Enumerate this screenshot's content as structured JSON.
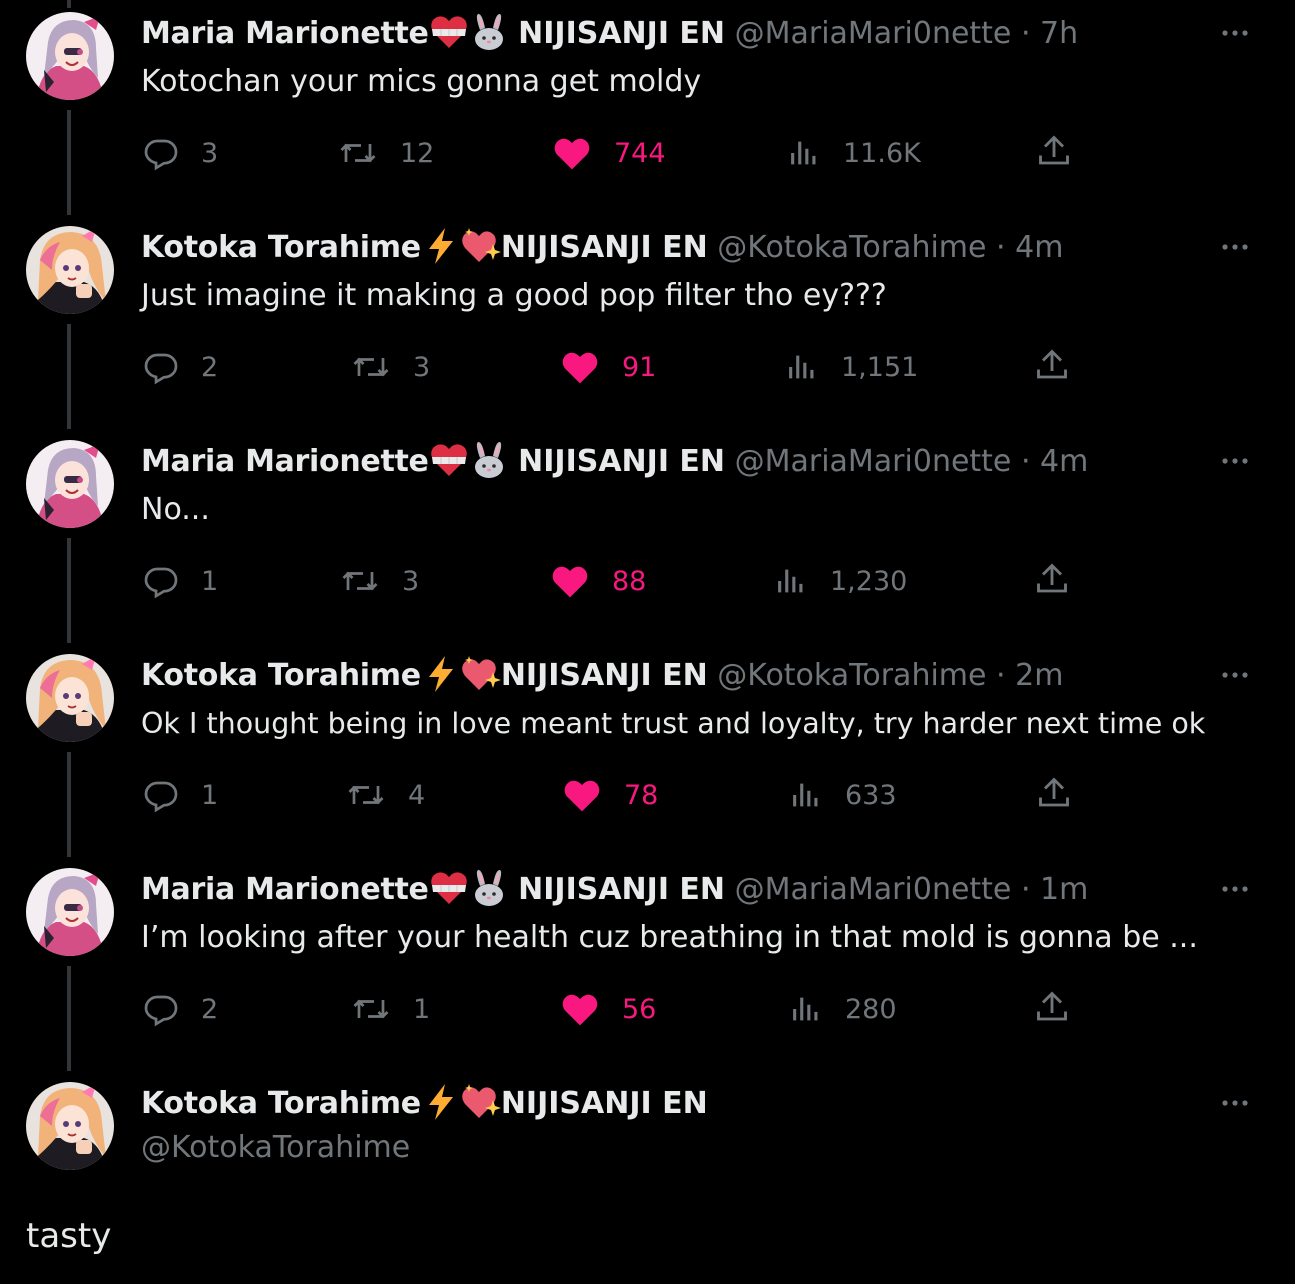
{
  "tweets": [
    {
      "name": "Maria Marionette",
      "affiliation": "NIJISANJI EN",
      "handle": "@MariaMari0nette",
      "time": "7h",
      "text": "Kotochan your mics gonna get moldy",
      "replies": "3",
      "reposts": "12",
      "likes": "744",
      "views": "11.6K",
      "avatar": "maria",
      "emoji1": "bandaged-heart-icon",
      "emoji2": "rabbit-icon"
    },
    {
      "name": "Kotoka Torahime",
      "affiliation": "NIJISANJI EN",
      "handle": "@KotokaTorahime",
      "time": "4m",
      "text": "Just imagine it making a good pop filter tho ey???",
      "replies": "2",
      "reposts": "3",
      "likes": "91",
      "views": "1,151",
      "avatar": "kotoka",
      "emoji1": "lightning-icon",
      "emoji2": "sparkling-heart-icon"
    },
    {
      "name": "Maria Marionette",
      "affiliation": "NIJISANJI EN",
      "handle": "@MariaMari0nette",
      "time": "4m",
      "text": "No...",
      "replies": "1",
      "reposts": "3",
      "likes": "88",
      "views": "1,230",
      "avatar": "maria",
      "emoji1": "bandaged-heart-icon",
      "emoji2": "rabbit-icon"
    },
    {
      "name": "Kotoka Torahime",
      "affiliation": "NIJISANJI EN",
      "handle": "@KotokaTorahime",
      "time": "2m",
      "text": "Ok I thought being in love meant trust and loyalty, try harder next time ok",
      "replies": "1",
      "reposts": "4",
      "likes": "78",
      "views": "633",
      "avatar": "kotoka",
      "emoji1": "lightning-icon",
      "emoji2": "sparkling-heart-icon"
    },
    {
      "name": "Maria Marionette",
      "affiliation": "NIJISANJI EN",
      "handle": "@MariaMari0nette",
      "time": "1m",
      "text": "I’m looking after your health cuz breathing in that mold is gonna be ...",
      "replies": "2",
      "reposts": "1",
      "likes": "56",
      "views": "280",
      "avatar": "maria",
      "emoji1": "bandaged-heart-icon",
      "emoji2": "rabbit-icon"
    }
  ],
  "detail": {
    "name": "Kotoka Torahime",
    "affiliation": "NIJISANJI EN",
    "handle": "@KotokaTorahime",
    "text": "tasty",
    "avatar": "kotoka"
  },
  "separator": "·",
  "colors": {
    "background": "#000000",
    "primary_text": "#e7e9ea",
    "secondary_text": "#71767b",
    "like": "#f91880",
    "thread_line": "#333639"
  }
}
